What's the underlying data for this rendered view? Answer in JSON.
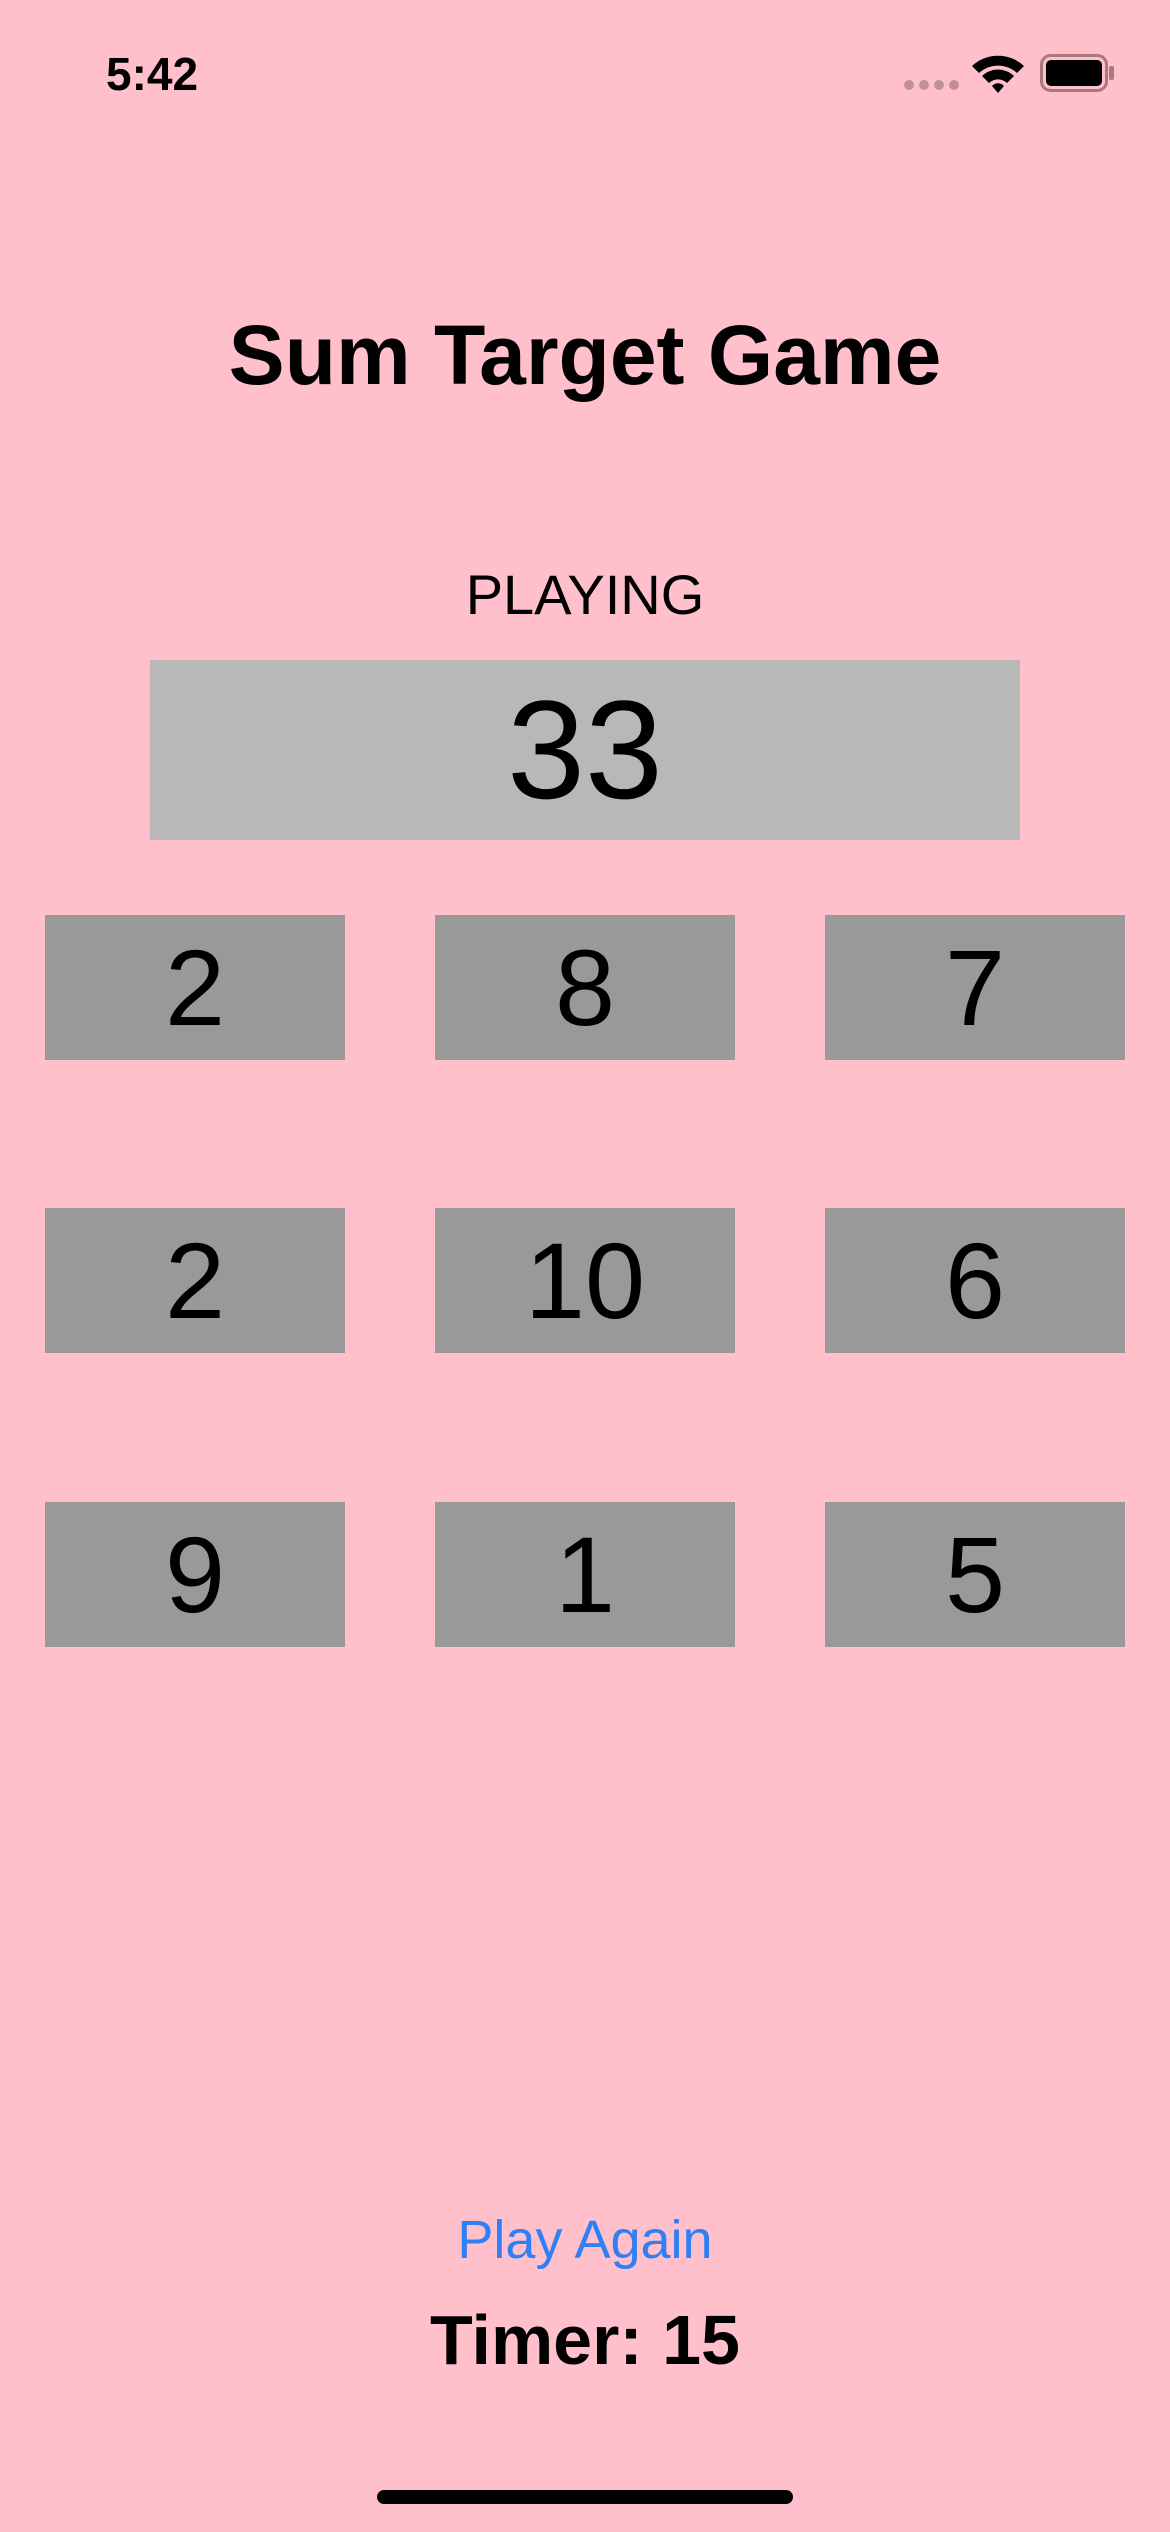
{
  "status_bar": {
    "time": "5:42"
  },
  "title": "Sum Target Game",
  "game": {
    "status": "PLAYING",
    "target": "33",
    "numbers": [
      "2",
      "8",
      "7",
      "2",
      "10",
      "6",
      "9",
      "1",
      "5"
    ]
  },
  "controls": {
    "play_again_label": "Play Again",
    "timer_text": "Timer: 15"
  },
  "colors": {
    "background": "#ffc0cb",
    "target_box": "#b8b8b8",
    "tile": "#999999",
    "link": "#2f7ff5"
  }
}
